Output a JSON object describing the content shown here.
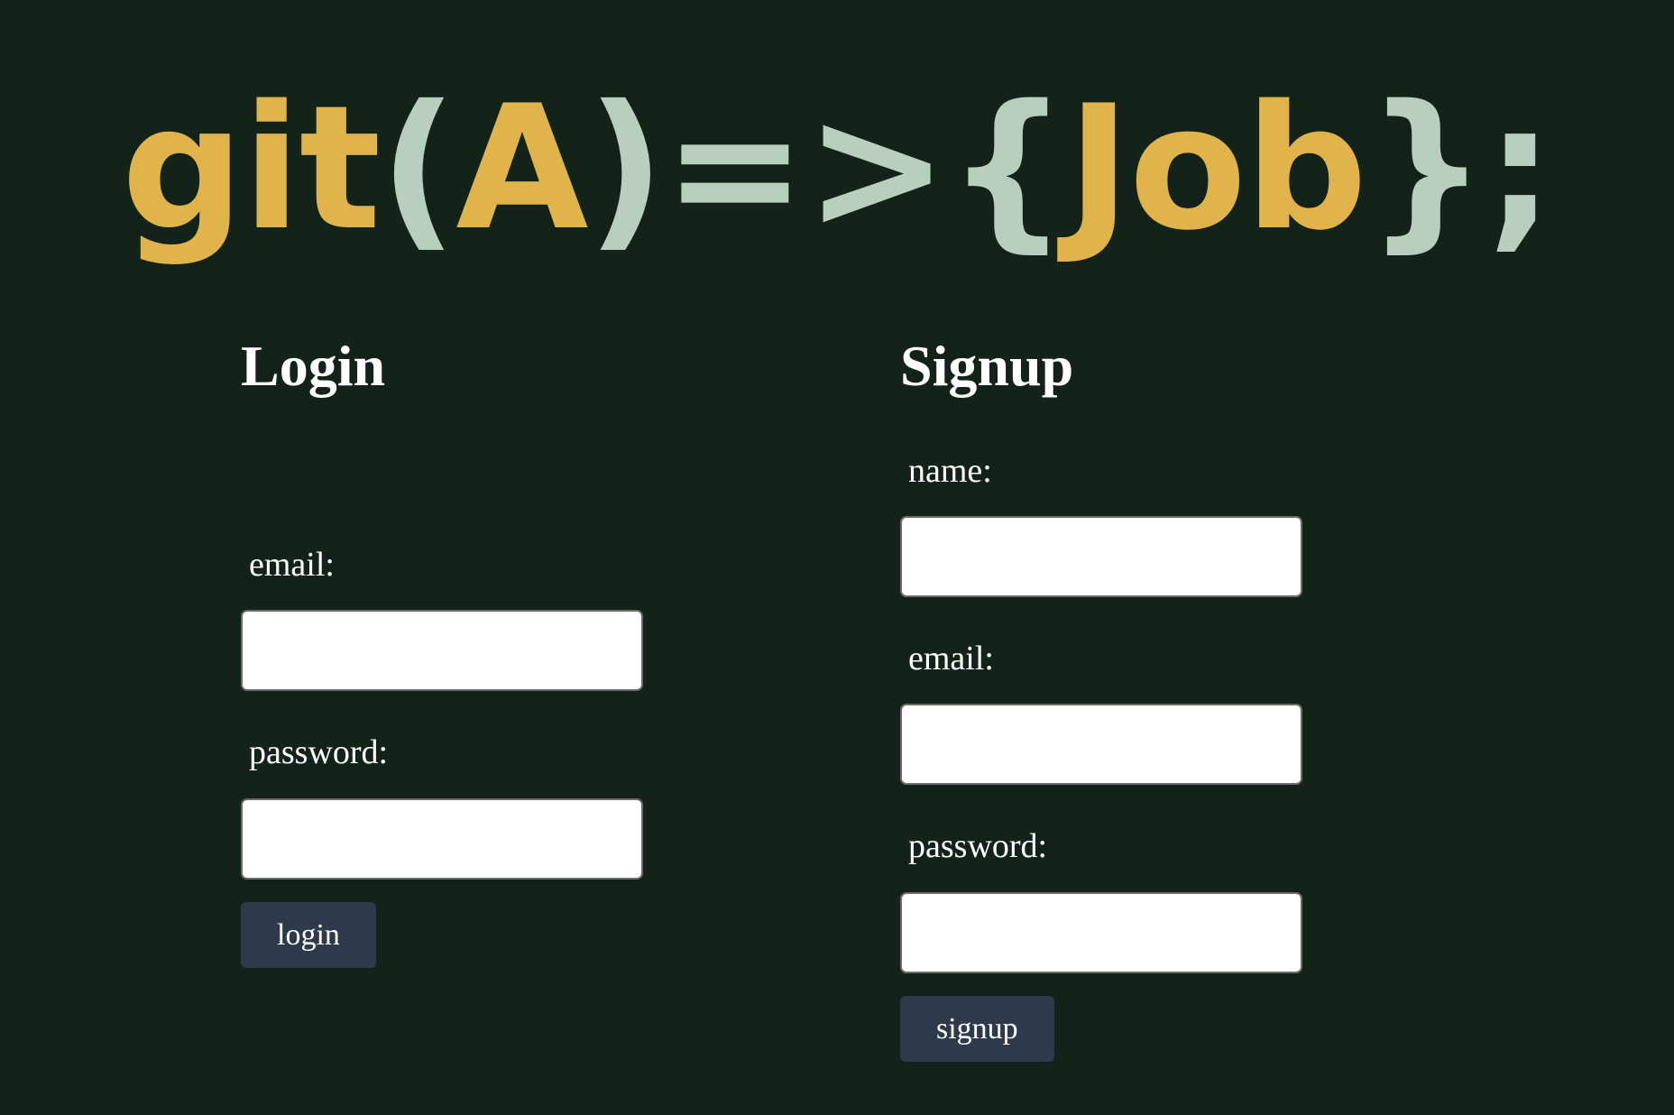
{
  "logo": {
    "part_git": "git",
    "part_open_paren": "(",
    "part_a": "A",
    "part_close_paren": ")",
    "part_arrow": "=>",
    "part_open_brace": "{",
    "part_job": "Job",
    "part_close_brace": "}",
    "part_semicolon": ";",
    "gold_color": "#e0b44a",
    "mint_color": "#b8cfc0"
  },
  "login": {
    "title": "Login",
    "email_label": "email:",
    "email_value": "",
    "password_label": "password:",
    "password_value": "",
    "submit_label": "login"
  },
  "signup": {
    "title": "Signup",
    "name_label": "name:",
    "name_value": "",
    "email_label": "email:",
    "email_value": "",
    "password_label": "password:",
    "password_value": "",
    "submit_label": "signup"
  },
  "colors": {
    "background": "#142319",
    "button": "#2e3a4b",
    "text": "#ffffff"
  }
}
